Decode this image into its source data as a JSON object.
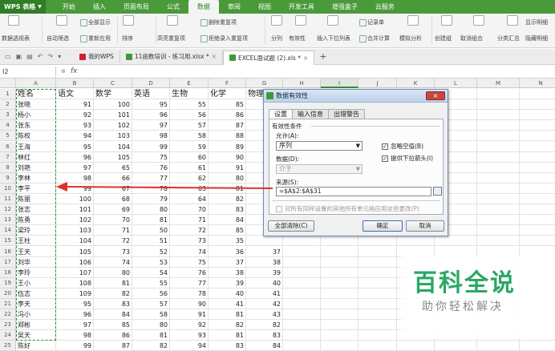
{
  "app": {
    "logo": "WPS 表格"
  },
  "menu": [
    "开始",
    "插入",
    "页面布局",
    "公式",
    "数据",
    "审阅",
    "视图",
    "开发工具",
    "增强盒子",
    "云服务"
  ],
  "menu_active": "数据",
  "ribbon": {
    "pivot": "数据透视表",
    "autofilter": "自动筛选",
    "show_all": "全部显示",
    "reapply": "重新应用",
    "sort": "排序",
    "highlight_dup": "高亮重复项",
    "delete_dup": "删除重复项",
    "reject_dup": "拒绝录入重复项",
    "split": "分列",
    "validity": "有效性",
    "insert_dropdown": "插入下拉列表",
    "merge_calc": "合并计算",
    "record_sheet": "记录单",
    "simulate": "模拟分析",
    "create_group": "创建组",
    "ungroup": "取消组合",
    "subtotal": "分类汇总",
    "show_detail": "显示明细",
    "hide_detail": "隐藏明细"
  },
  "tabs": [
    {
      "label": "我的WPS",
      "kind": "wps"
    },
    {
      "label": "11函数培训 - 练习用.xlsx *",
      "kind": "sheet"
    },
    {
      "label": "EXCEL面试题 (2).xls *",
      "kind": "sheet",
      "active": true
    }
  ],
  "formula": {
    "cell_ref": "I2",
    "fx": "fx",
    "content": ""
  },
  "columns": [
    "A",
    "B",
    "C",
    "D",
    "E",
    "F",
    "G",
    "H",
    "I",
    "J",
    "K",
    "L",
    "M",
    "N"
  ],
  "selected_column": "I",
  "headers": [
    "姓名",
    "语文",
    "数学",
    "英语",
    "生物",
    "化学",
    "物理"
  ],
  "rows": [
    [
      "张晓",
      "91",
      "100",
      "95",
      "55",
      "85",
      ""
    ],
    [
      "杨小",
      "92",
      "101",
      "96",
      "56",
      "86",
      ""
    ],
    [
      "张东",
      "93",
      "102",
      "97",
      "57",
      "87",
      ""
    ],
    [
      "陈权",
      "94",
      "103",
      "98",
      "58",
      "88",
      ""
    ],
    [
      "王海",
      "95",
      "104",
      "99",
      "59",
      "89",
      ""
    ],
    [
      "林红",
      "96",
      "105",
      "75",
      "60",
      "90",
      ""
    ],
    [
      "刘艳",
      "97",
      "65",
      "76",
      "61",
      "91",
      ""
    ],
    [
      "李林",
      "98",
      "66",
      "77",
      "62",
      "80",
      ""
    ],
    [
      "李平",
      "99",
      "67",
      "78",
      "63",
      "81",
      ""
    ],
    [
      "陈丽",
      "100",
      "68",
      "79",
      "64",
      "82",
      ""
    ],
    [
      "张志",
      "101",
      "69",
      "80",
      "70",
      "83",
      ""
    ],
    [
      "陈勇",
      "102",
      "70",
      "81",
      "71",
      "84",
      ""
    ],
    [
      "梁玲",
      "103",
      "71",
      "50",
      "72",
      "85",
      ""
    ],
    [
      "王柱",
      "104",
      "72",
      "51",
      "73",
      "35",
      ""
    ],
    [
      "王天",
      "105",
      "73",
      "52",
      "74",
      "36",
      "37"
    ],
    [
      "刘华",
      "106",
      "74",
      "53",
      "75",
      "37",
      "38"
    ],
    [
      "李玲",
      "107",
      "80",
      "54",
      "76",
      "38",
      "39"
    ],
    [
      "王小",
      "108",
      "81",
      "55",
      "77",
      "39",
      "40"
    ],
    [
      "伍志",
      "109",
      "82",
      "56",
      "78",
      "40",
      "41"
    ],
    [
      "李天",
      "95",
      "83",
      "57",
      "90",
      "41",
      "42"
    ],
    [
      "冯小",
      "96",
      "84",
      "58",
      "91",
      "81",
      "43"
    ],
    [
      "郑彬",
      "97",
      "85",
      "80",
      "92",
      "82",
      "82"
    ],
    [
      "吴天",
      "98",
      "86",
      "81",
      "93",
      "81",
      "83"
    ],
    [
      "陈好",
      "99",
      "87",
      "82",
      "94",
      "83",
      "84"
    ]
  ],
  "dialog": {
    "title": "数据有效性",
    "close": "×",
    "tabs": [
      "设置",
      "输入信息",
      "出错警告"
    ],
    "section": "有效性条件",
    "allow_label": "允许(A):",
    "allow_value": "序列",
    "ignore_blank": "忽略空值(B)",
    "provide_dropdown": "提供下拉箭头(I)",
    "data_label": "数据(D):",
    "data_value": "介于",
    "source_label": "来源(S):",
    "source_value": "=$A$2:$A$31",
    "apply_all": "对所有同样设置的其他所有单元格应用这些更改(P)",
    "clear_all": "全部清除(C)",
    "ok": "确定",
    "cancel": "取消"
  },
  "watermark": {
    "title": "百科全说",
    "subtitle": "助你轻松解决"
  }
}
